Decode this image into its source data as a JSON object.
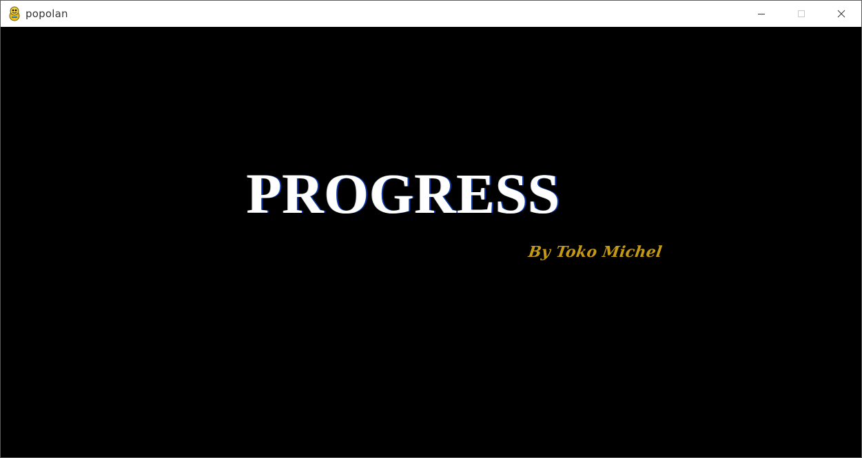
{
  "window": {
    "title": "popolan",
    "icon": "python-snake-icon",
    "controls": {
      "minimize": "minimize-icon",
      "maximize": "maximize-icon",
      "close": "close-icon"
    }
  },
  "game": {
    "title": "PROGRESS",
    "byline": "By Toko Michel",
    "colors": {
      "background": "#000000",
      "title": "#ffffff",
      "byline": "#c49a14"
    }
  }
}
